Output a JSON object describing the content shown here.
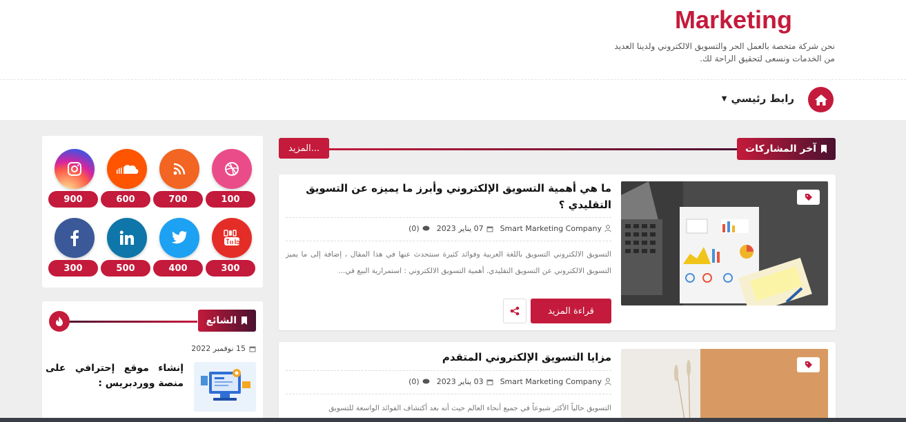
{
  "header": {
    "logo": "Marketing",
    "tagline": "نحن شركة متخصة بالعمل الحر والتسويق الالكتروني ولدينا العديد من الخدمات ونسعى لتحقيق الراحة لك."
  },
  "nav": {
    "home_icon": "home-icon",
    "main_link": "رابط رئيسي"
  },
  "latest": {
    "title": "آخر المشاركات",
    "more": "المزيد..."
  },
  "posts": [
    {
      "title": "ما هي أهمية التسويق الإلكتروني وأبرز ما يميزه عن التسويق التقليدي ؟",
      "author": "Smart Marketing Company",
      "date": "07 يناير 2023",
      "comments": "(0)",
      "excerpt": "التسويق الالكتروني  التسويق باللغة العربية وفوائد كثيرة سنتحدث عنها في هذا المقال ، إضافة إلى ما يميز التسويق الالكتروني عن التسويق التقليدي. أهمية التسويق الالكتروني : استمرارية البيع في...",
      "read_more": "قراءة المزيد"
    },
    {
      "title": "مزايا التسويق الإلكتروني المتقدم",
      "author": "Smart Marketing Company",
      "date": "03 يناير 2023",
      "comments": "(0)",
      "excerpt": "التسويق حالياً الأكثر شيوعاً في جميع أنحاء العالم حيث أنه بعد أكتشاف الفوائد الواسعة للتسويق"
    }
  ],
  "social": [
    {
      "name": "dribbble",
      "count": "100",
      "color": "#ea4c89"
    },
    {
      "name": "rss",
      "count": "700",
      "color": "#f26522"
    },
    {
      "name": "soundcloud",
      "count": "600",
      "color": "#ff5500"
    },
    {
      "name": "instagram",
      "count": "900",
      "color": "#c13584"
    },
    {
      "name": "youtube",
      "count": "300",
      "color": "#e52d27"
    },
    {
      "name": "twitter",
      "count": "400",
      "color": "#1da1f2"
    },
    {
      "name": "linkedin",
      "count": "500",
      "color": "#0e76a8"
    },
    {
      "name": "facebook",
      "count": "300",
      "color": "#3b5998"
    }
  ],
  "popular": {
    "title": "الشائع",
    "date": "15 نوفمبر 2022",
    "item_title": "إنشاء موقع إحترافي على منصة ووردبريس :"
  },
  "colors": {
    "accent": "#c41a3b",
    "accent_dark": "#4a1230"
  }
}
